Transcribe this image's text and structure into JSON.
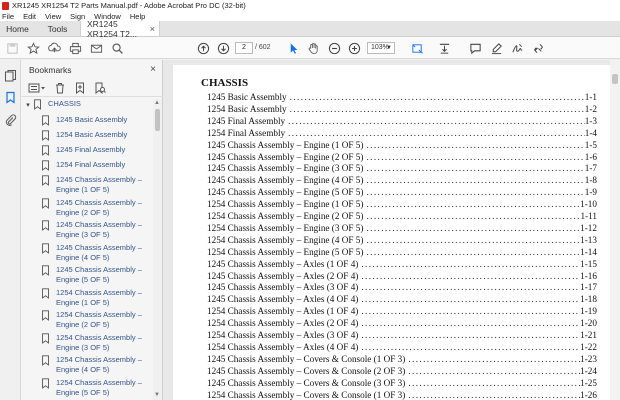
{
  "window": {
    "title": "XR1245 XR1254 T2 Parts Manual.pdf - Adobe Acrobat Pro DC (32-bit)"
  },
  "menu": [
    "File",
    "Edit",
    "View",
    "Sign",
    "Window",
    "Help"
  ],
  "tabs": {
    "home": "Home",
    "tools": "Tools",
    "document": "XR1245 XR1254 T2...",
    "document_close": "×"
  },
  "toolbar": {
    "current_page": "2",
    "page_total": "/ 602",
    "zoom": "103%"
  },
  "panel": {
    "title": "Bookmarks",
    "close": "×",
    "bookmarks": [
      {
        "label": "CHASSIS",
        "parent": true
      },
      {
        "label": "1245 Basic Assembly"
      },
      {
        "label": "1254 Basic Assembly"
      },
      {
        "label": "1245 Final Assembly"
      },
      {
        "label": "1254 Final Assembly"
      },
      {
        "label": "1245 Chassis Assembly – Engine (1 OF 5)"
      },
      {
        "label": "1245 Chassis Assembly – Engine (2 OF 5)"
      },
      {
        "label": "1245 Chassis Assembly – Engine (3 OF 5)"
      },
      {
        "label": "1245 Chassis Assembly – Engine (4 OF 5)"
      },
      {
        "label": "1245 Chassis Assembly – Engine (5 OF 5)"
      },
      {
        "label": "1254 Chassis Assembly – Engine (1 OF 5)"
      },
      {
        "label": "1254 Chassis Assembly – Engine (2 OF 5)"
      },
      {
        "label": "1254 Chassis Assembly – Engine (3 OF 5)"
      },
      {
        "label": "1254 Chassis Assembly – Engine (4 OF 5)"
      },
      {
        "label": "1254 Chassis Assembly – Engine (5 OF 5)"
      }
    ]
  },
  "document": {
    "heading": "CHASSIS",
    "toc": [
      {
        "name": "1245 Basic Assembly",
        "page": "1-1"
      },
      {
        "name": "1254 Basic Assembly",
        "page": "1-2"
      },
      {
        "name": "1245 Final Assembly",
        "page": "1-3"
      },
      {
        "name": "1254 Final Assembly",
        "page": "1-4"
      },
      {
        "name": "1245 Chassis Assembly – Engine (1 OF 5)",
        "page": "1-5"
      },
      {
        "name": "1245 Chassis Assembly – Engine (2 OF 5)",
        "page": "1-6"
      },
      {
        "name": "1245 Chassis Assembly – Engine (3 OF 5)",
        "page": "1-7"
      },
      {
        "name": "1245 Chassis Assembly – Engine (4 OF 5)",
        "page": "1-8"
      },
      {
        "name": "1245 Chassis Assembly – Engine (5 OF 5)",
        "page": "1-9"
      },
      {
        "name": "1254 Chassis Assembly – Engine (1 OF 5)",
        "page": "1-10"
      },
      {
        "name": "1254 Chassis Assembly – Engine (2 OF 5)",
        "page": "1-11"
      },
      {
        "name": "1254 Chassis Assembly – Engine (3 OF 5)",
        "page": "1-12"
      },
      {
        "name": "1254 Chassis Assembly – Engine (4 OF 5)",
        "page": "1-13"
      },
      {
        "name": "1254 Chassis Assembly – Engine (5 OF 5)",
        "page": "1-14"
      },
      {
        "name": "1245 Chassis Assembly – Axles (1 OF 4)",
        "page": "1-15"
      },
      {
        "name": "1245 Chassis Assembly – Axles (2 OF 4)",
        "page": "1-16"
      },
      {
        "name": "1245 Chassis Assembly – Axles (3 OF 4)",
        "page": "1-17"
      },
      {
        "name": "1245 Chassis Assembly – Axles (4 OF 4)",
        "page": "1-18"
      },
      {
        "name": "1254 Chassis Assembly – Axles (1 OF 4)",
        "page": "1-19"
      },
      {
        "name": "1254 Chassis Assembly – Axles (2 OF 4)",
        "page": "1-20"
      },
      {
        "name": "1254 Chassis Assembly – Axles (3 OF 4)",
        "page": "1-21"
      },
      {
        "name": "1254 Chassis Assembly – Axles (4 OF 4)",
        "page": "1-22"
      },
      {
        "name": "1245 Chassis Assembly – Covers & Console (1 OF 3)",
        "page": "1-23"
      },
      {
        "name": "1245 Chassis Assembly – Covers & Console (2 OF 3)",
        "page": "1-24"
      },
      {
        "name": "1245 Chassis Assembly – Covers & Console (3 OF 3)",
        "page": "1-25"
      },
      {
        "name": "1254 Chassis Assembly – Covers & Console (1 OF 3)",
        "page": "1-26"
      }
    ]
  }
}
